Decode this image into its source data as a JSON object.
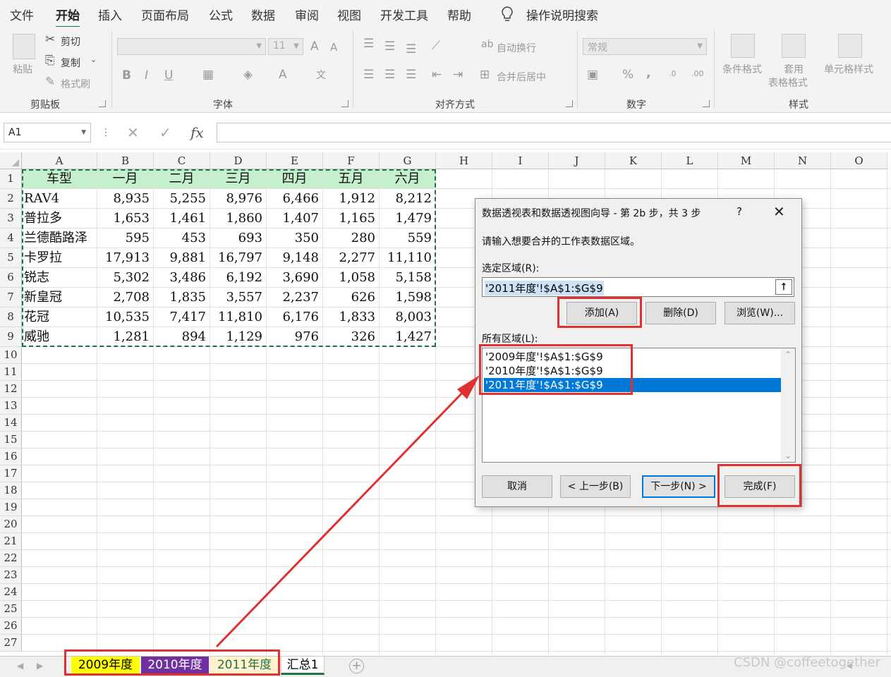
{
  "ribbon_tabs": [
    "文件",
    "开始",
    "插入",
    "页面布局",
    "公式",
    "数据",
    "审阅",
    "视图",
    "开发工具",
    "帮助"
  ],
  "active_tab": "开始",
  "tell_me": "操作说明搜索",
  "ribbon": {
    "clipboard": {
      "paste": "粘贴",
      "cut": "剪切",
      "copy": "复制",
      "format_painter": "格式刷",
      "label": "剪贴板"
    },
    "font": {
      "size": "11",
      "label": "字体",
      "bold": "B",
      "italic": "I",
      "underline": "U",
      "grow": "A",
      "shrink": "A"
    },
    "alignment": {
      "wrap": "自动换行",
      "merge": "合并后居中",
      "label": "对齐方式"
    },
    "number": {
      "format": "常规",
      "label": "数字",
      "percent": "%",
      "comma": ","
    },
    "styles": {
      "conditional": "条件格式",
      "table1": "套用",
      "table2": "表格格式",
      "cell_styles": "单元格样式",
      "label": "样式"
    }
  },
  "formula_bar": {
    "name_box": "A1",
    "cancel": "✕",
    "enter": "✓",
    "fx": "fx",
    "value": ""
  },
  "columns": [
    "A",
    "B",
    "C",
    "D",
    "E",
    "F",
    "G",
    "H",
    "I",
    "J",
    "K",
    "L",
    "M",
    "N",
    "O"
  ],
  "rows": [
    "1",
    "2",
    "3",
    "4",
    "5",
    "6",
    "7",
    "8",
    "9",
    "10",
    "11",
    "12",
    "13",
    "14",
    "15",
    "16",
    "17",
    "18",
    "19",
    "20",
    "21",
    "22",
    "23",
    "24",
    "25",
    "26",
    "27"
  ],
  "table": {
    "header": [
      "车型",
      "一月",
      "二月",
      "三月",
      "四月",
      "五月",
      "六月"
    ],
    "rows": [
      [
        "RAV4",
        "8,935",
        "5,255",
        "8,976",
        "6,466",
        "1,912",
        "8,212"
      ],
      [
        "普拉多",
        "1,653",
        "1,461",
        "1,860",
        "1,407",
        "1,165",
        "1,479"
      ],
      [
        "兰德酷路泽",
        "595",
        "453",
        "693",
        "350",
        "280",
        "559"
      ],
      [
        "卡罗拉",
        "17,913",
        "9,881",
        "16,797",
        "9,148",
        "2,277",
        "11,110"
      ],
      [
        "锐志",
        "5,302",
        "3,486",
        "6,192",
        "3,690",
        "1,058",
        "5,158"
      ],
      [
        "新皇冠",
        "2,708",
        "1,835",
        "3,557",
        "2,237",
        "626",
        "1,598"
      ],
      [
        "花冠",
        "10,535",
        "7,417",
        "11,810",
        "6,176",
        "1,833",
        "8,003"
      ],
      [
        "威驰",
        "1,281",
        "894",
        "1,129",
        "976",
        "326",
        "1,427"
      ]
    ]
  },
  "sheet_tabs": [
    {
      "label": "2009年度",
      "bg": "#ffff00",
      "fg": "#000000"
    },
    {
      "label": "2010年度",
      "bg": "#7030a0",
      "fg": "#ffffff"
    },
    {
      "label": "2011年度",
      "bg": "#fff2cc",
      "fg": "#217346"
    },
    {
      "label": "汇总1",
      "bg": "#ffffff",
      "fg": "#000000"
    }
  ],
  "add_sheet": "+",
  "watermark": "CSDN @coffeetogether",
  "dialog": {
    "title": "数据透视表和数据透视图向导 - 第 2b 步，共 3 步",
    "help": "?",
    "close": "✕",
    "instruction": "请输入想要合并的工作表数据区域。",
    "range_label": "选定区域(R):",
    "range_value": "'2011年度'!$A$1:$G$9",
    "add": "添加(A)",
    "delete": "删除(D)",
    "browse": "浏览(W)...",
    "all_ranges_label": "所有区域(L):",
    "all_ranges": [
      "'2009年度'!$A$1:$G$9",
      "'2010年度'!$A$1:$G$9",
      "'2011年度'!$A$1:$G$9"
    ],
    "selected_index": 2,
    "cancel": "取消",
    "back": "< 上一步(B)",
    "next": "下一步(N) >",
    "finish": "完成(F)"
  },
  "colors": {
    "accent": "#217346",
    "header_fill": "#c6efce",
    "selection": "#0078d7",
    "annotation": "#e03030"
  }
}
